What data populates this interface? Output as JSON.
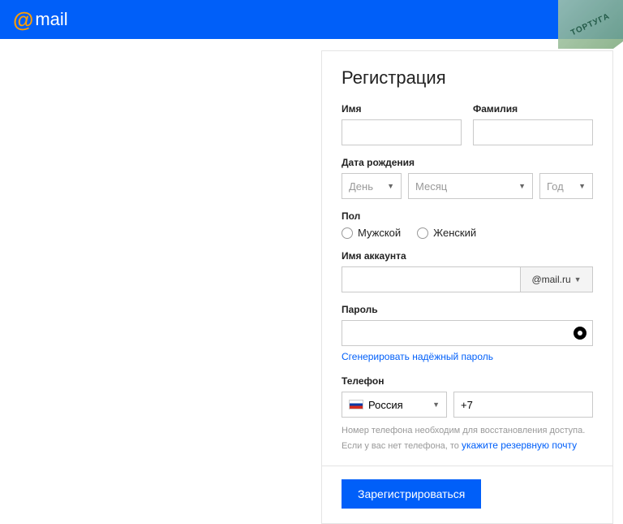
{
  "header": {
    "logo_text": "mail"
  },
  "watermark": "ТОРТУГА",
  "form": {
    "title": "Регистрация",
    "first_name_label": "Имя",
    "last_name_label": "Фамилия",
    "dob_label": "Дата рождения",
    "dob_day": "День",
    "dob_month": "Месяц",
    "dob_year": "Год",
    "gender_label": "Пол",
    "gender_male": "Мужской",
    "gender_female": "Женский",
    "account_label": "Имя аккаунта",
    "domain": "@mail.ru",
    "password_label": "Пароль",
    "gen_password": "Сгенерировать надёжный пароль",
    "phone_label": "Телефон",
    "phone_country": "Россия",
    "phone_prefix": "+7",
    "phone_hint1": "Номер телефона необходим для восстановления доступа.",
    "phone_hint2": "Если у вас нет телефона, то ",
    "phone_hint_link": "укажите резервную почту",
    "submit": "Зарегистрироваться"
  }
}
